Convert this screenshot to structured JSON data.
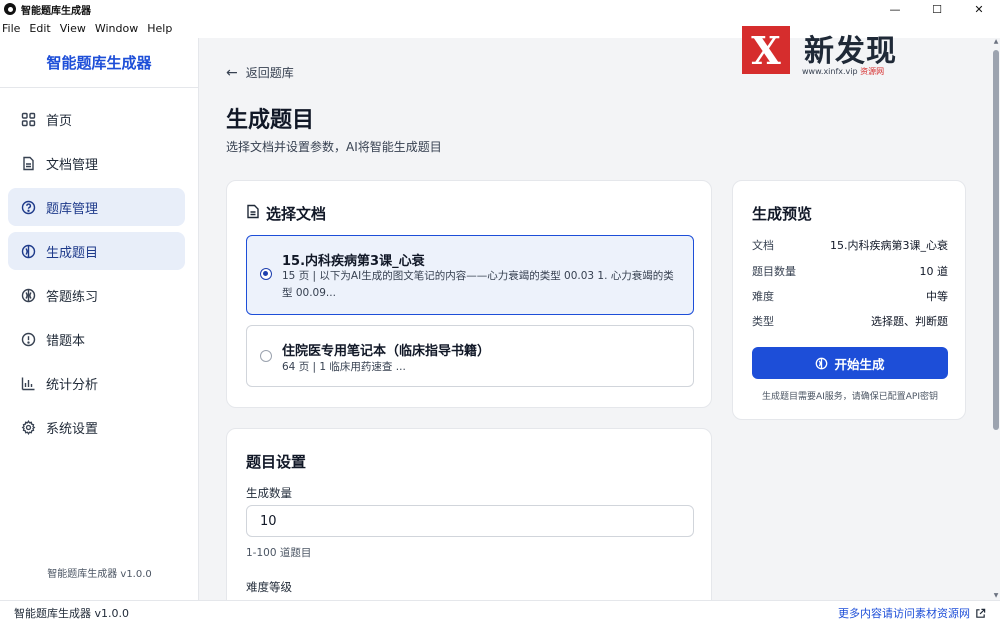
{
  "window": {
    "title": "智能题库生成器",
    "controls": {
      "minimize": "—",
      "maximize": "☐",
      "close": "✕"
    }
  },
  "menu": [
    "File",
    "Edit",
    "View",
    "Window",
    "Help"
  ],
  "sidebar": {
    "brand": "智能题库生成器",
    "items": [
      {
        "label": "首页",
        "icon": "grid-icon"
      },
      {
        "label": "文档管理",
        "icon": "document-icon"
      },
      {
        "label": "题库管理",
        "icon": "question-circle-icon"
      },
      {
        "label": "生成题目",
        "icon": "generate-icon"
      },
      {
        "label": "答题练习",
        "icon": "practice-icon"
      },
      {
        "label": "错题本",
        "icon": "alert-circle-icon"
      },
      {
        "label": "统计分析",
        "icon": "bar-chart-icon"
      },
      {
        "label": "系统设置",
        "icon": "gear-icon"
      }
    ],
    "version": "智能题库生成器 v1.0.0"
  },
  "main": {
    "back_label": "返回题库",
    "title": "生成题目",
    "subtitle": "选择文档并设置参数，AI将智能生成题目",
    "select_doc": {
      "title": "选择文档",
      "docs": [
        {
          "name": "15.内科疾病第3课_心衰",
          "desc": "15 页 | 以下为AI生成的图文笔记的内容——心力衰竭的类型 00.03 1. 心力衰竭的类型 00.09..."
        },
        {
          "name": "住院医专用笔记本（临床指导书籍）",
          "desc": "64 页 | 1 临床用药速查 ..."
        }
      ]
    },
    "settings": {
      "title": "题目设置",
      "count_label": "生成数量",
      "count_value": "10",
      "count_hint": "1-100 道题目",
      "difficulty_label": "难度等级"
    },
    "preview": {
      "title": "生成预览",
      "rows": [
        {
          "k": "文档",
          "v": "15.内科疾病第3课_心衰"
        },
        {
          "k": "题目数量",
          "v": "10 道"
        },
        {
          "k": "难度",
          "v": "中等"
        },
        {
          "k": "类型",
          "v": "选择题、判断题"
        }
      ],
      "button": "开始生成",
      "note": "生成题目需要AI服务，请确保已配置API密钥"
    }
  },
  "watermark": {
    "mark": "X",
    "text": "新发现",
    "url": "www.xinfx.vip",
    "url_suffix": "资源网"
  },
  "statusbar": {
    "left": "智能题库生成器 v1.0.0",
    "right": "更多内容请访问素材资源网"
  },
  "colors": {
    "accent": "#1d4ed8",
    "active_nav_bg": "#e8eef9",
    "watermark_red": "#d62d2d"
  }
}
